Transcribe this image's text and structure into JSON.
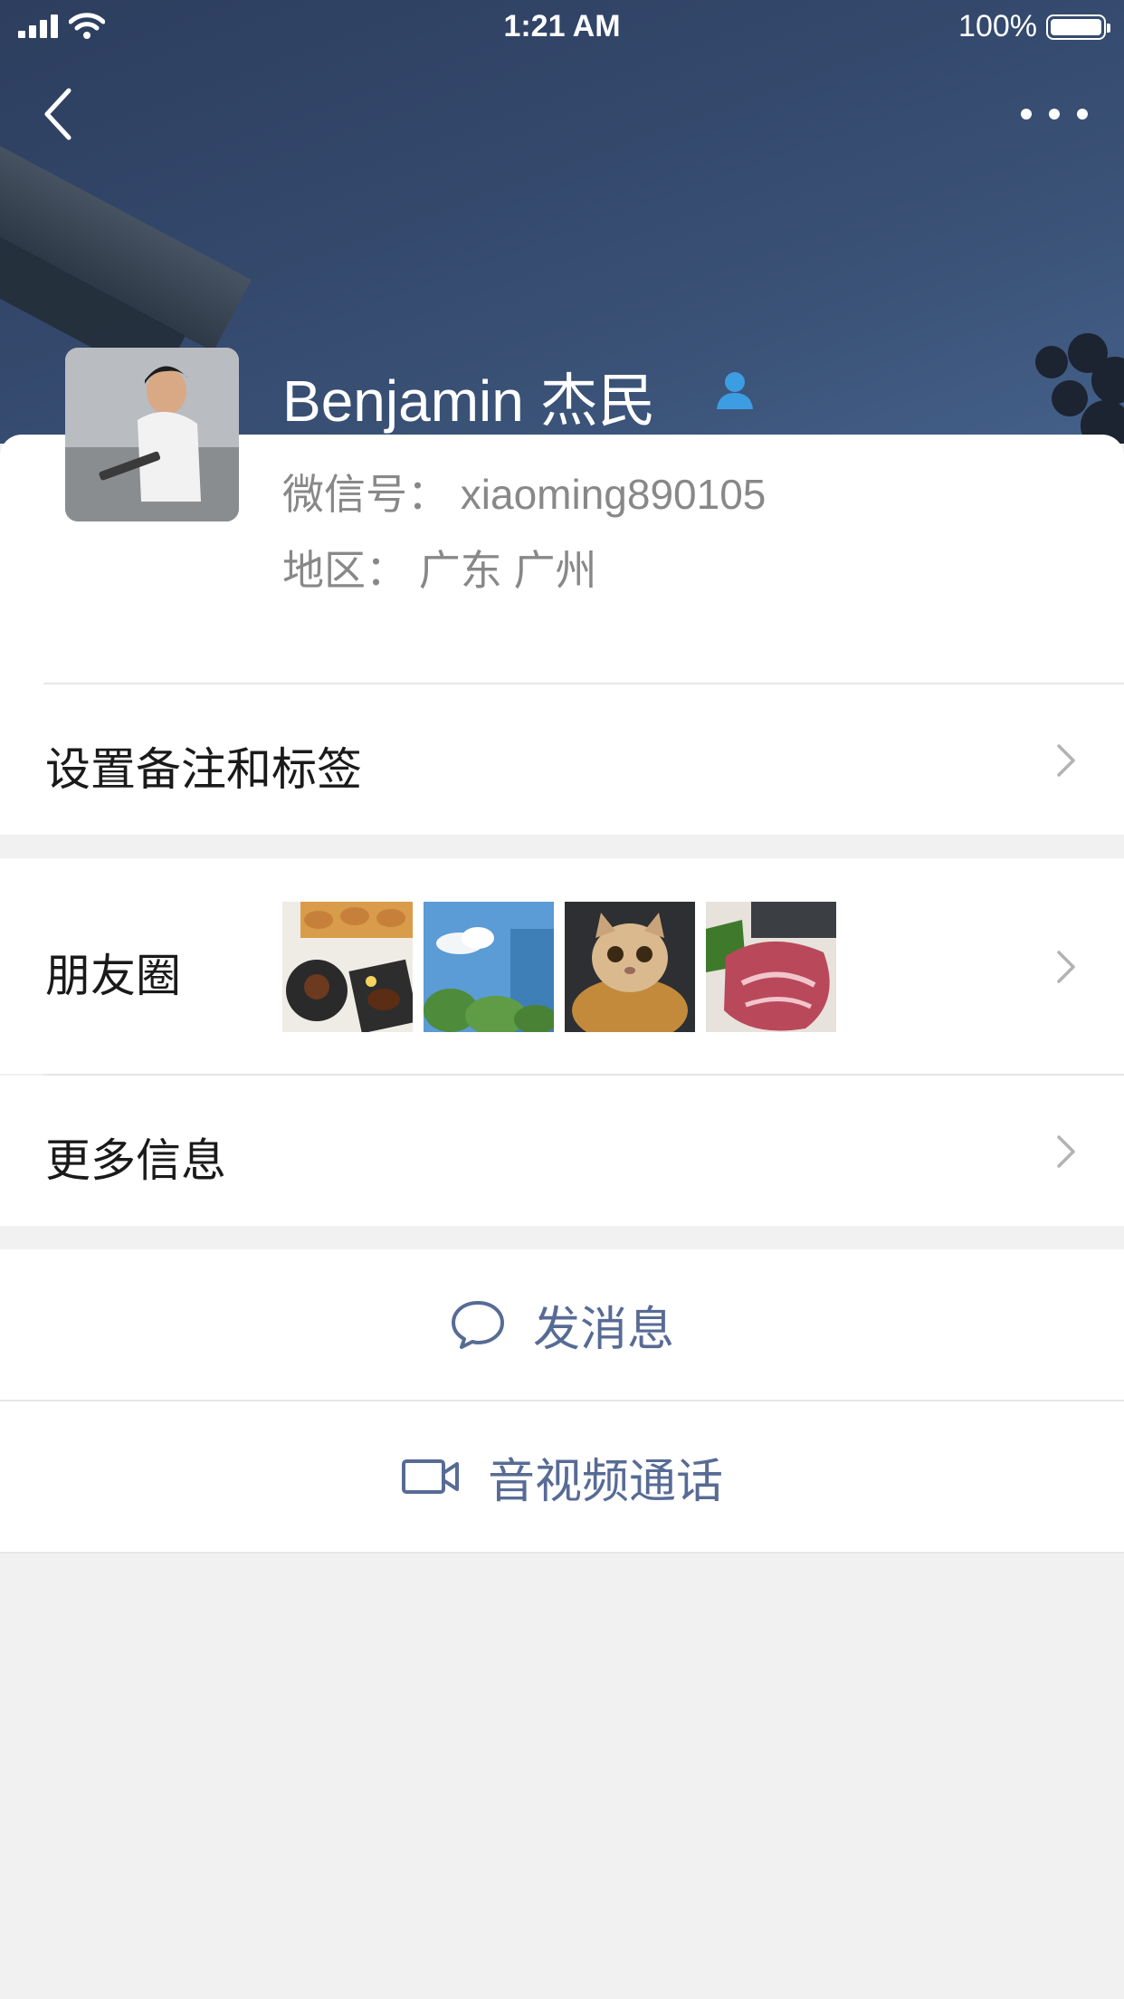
{
  "status_bar": {
    "time": "1:21 AM",
    "battery": "100%"
  },
  "profile": {
    "name": "Benjamin 杰民",
    "wechat_id": "微信号： xiaoming890105",
    "region": "地区： 广东 广州"
  },
  "menu": {
    "remark_tags": "设置备注和标签",
    "moments": "朋友圈",
    "more_info": "更多信息"
  },
  "actions": {
    "message": "发消息",
    "video_call": "音视频通话"
  },
  "colors": {
    "accent": "#576b95",
    "header": "#34496d",
    "background": "#f1f1f1"
  }
}
